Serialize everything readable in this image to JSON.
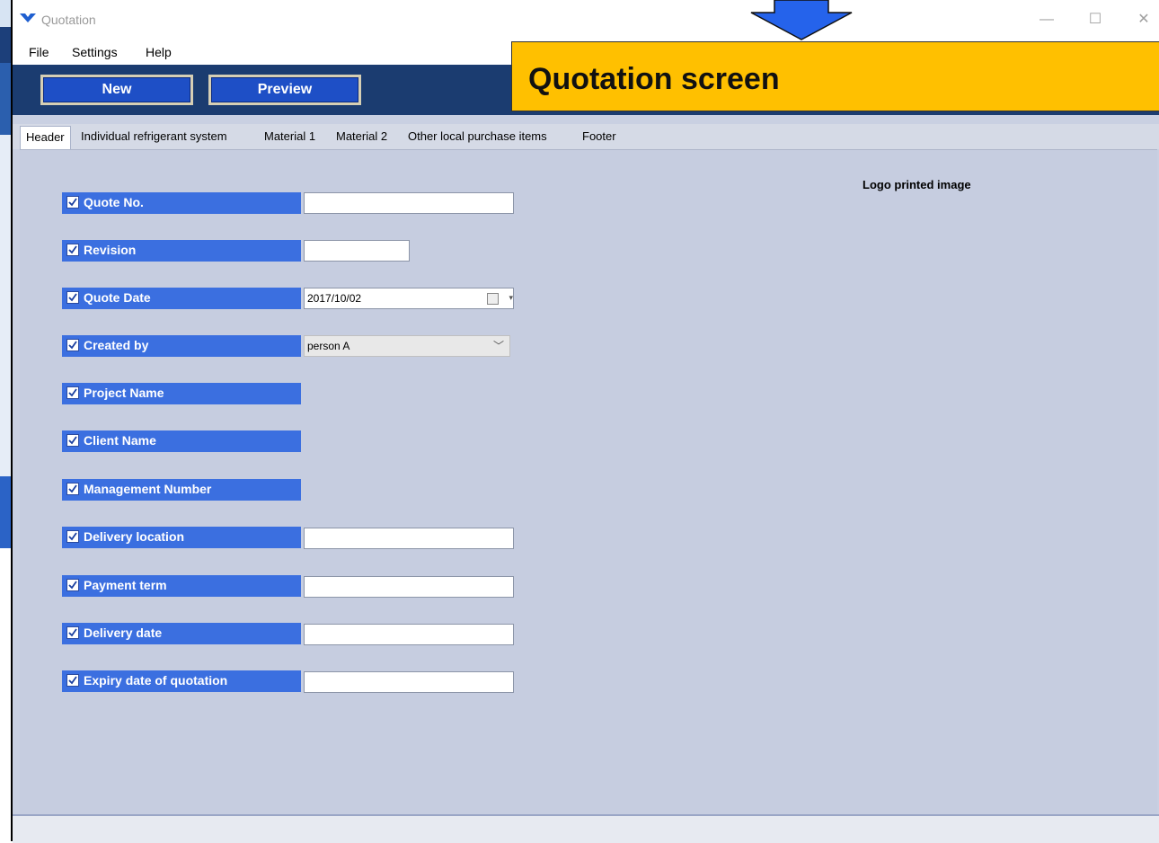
{
  "window": {
    "title": "Quotation"
  },
  "menu": [
    "File",
    "Settings",
    "Help"
  ],
  "toolbar": {
    "new_label": "New",
    "preview_label": "Preview"
  },
  "callout": {
    "text": "Quotation screen",
    "color": "#ffc000"
  },
  "tabs": [
    "Header",
    "Individual refrigerant system",
    "Material 1",
    "Material 2",
    "Other local purchase items",
    "Footer"
  ],
  "active_tab": "Header",
  "fields": [
    {
      "label": "Quote No.",
      "checked": true,
      "input": "text",
      "value": ""
    },
    {
      "label": "Revision",
      "checked": true,
      "input": "text",
      "value": ""
    },
    {
      "label": "Quote Date",
      "checked": true,
      "input": "date",
      "value": "2017/10/02"
    },
    {
      "label": "Created by",
      "checked": true,
      "input": "select",
      "value": "person A"
    },
    {
      "label": "Project Name",
      "checked": true,
      "input": "none"
    },
    {
      "label": "Client Name",
      "checked": true,
      "input": "none"
    },
    {
      "label": "Management Number",
      "checked": true,
      "input": "none"
    },
    {
      "label": "Delivery location",
      "checked": true,
      "input": "text",
      "value": ""
    },
    {
      "label": "Payment term",
      "checked": true,
      "input": "text",
      "value": ""
    },
    {
      "label": "Delivery date",
      "checked": true,
      "input": "text",
      "value": ""
    },
    {
      "label": "Expiry date of quotation",
      "checked": true,
      "input": "text",
      "value": ""
    }
  ],
  "logo_label": "Logo printed image",
  "colors": {
    "label_bg": "#3b6fe0",
    "toolbar_bg": "#1b3c70",
    "content_bg": "#c6cde0",
    "arrow": "#2563eb"
  }
}
